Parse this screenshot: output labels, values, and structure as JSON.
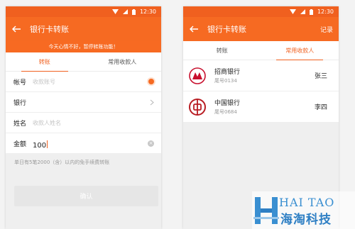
{
  "status": {
    "time": "12:30"
  },
  "left": {
    "title": "银行卡转账",
    "notice": "今天心情不好，暂停转账功能！",
    "tabs": [
      {
        "label": "转账",
        "active": true
      },
      {
        "label": "常用收款人",
        "active": false
      }
    ],
    "form": {
      "account_label": "帐号",
      "account_placeholder": "收款账号",
      "bank_label": "银行",
      "name_label": "姓名",
      "name_placeholder": "收款人姓名",
      "amount_label": "金额",
      "amount_value": "100"
    },
    "hint": "单日有5笔2000（含）以内的免手续费转账",
    "confirm_label": "确认"
  },
  "right": {
    "title": "银行卡转账",
    "action": "记录",
    "tabs": [
      {
        "label": "转账",
        "active": false
      },
      {
        "label": "常用收款人",
        "active": true
      }
    ],
    "payees": [
      {
        "bank": "招商银行",
        "tail": "尾号0134",
        "name": "张三",
        "logo_color": "#c8102e"
      },
      {
        "bank": "中国银行",
        "tail": "尾号0684",
        "name": "李四",
        "logo_color": "#b81c22"
      }
    ]
  },
  "watermark": {
    "en": "HAI TAO",
    "cn": "海淘科技"
  },
  "colors": {
    "primary": "#f66a22",
    "status_bar": "#f0601f"
  }
}
